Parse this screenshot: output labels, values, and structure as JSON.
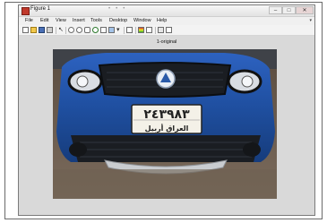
{
  "window": {
    "title": "Figure 1",
    "minimize_icon": "minimize-icon",
    "maximize_icon": "maximize-icon",
    "close_icon": "close-icon"
  },
  "menu": {
    "items": [
      "File",
      "Edit",
      "View",
      "Insert",
      "Tools",
      "Desktop",
      "Window",
      "Help"
    ]
  },
  "toolbar": {
    "icons": [
      "new-figure-icon",
      "open-file-icon",
      "save-icon",
      "print-icon",
      "edit-plot-arrow-icon",
      "zoom-in-icon",
      "zoom-out-icon",
      "pan-icon",
      "rotate-3d-icon",
      "data-cursor-icon",
      "brush-icon",
      "link-icon",
      "insert-colorbar-icon",
      "insert-legend-icon",
      "hide-plot-tools-icon",
      "show-plot-tools-icon"
    ]
  },
  "figure": {
    "axes_title": "1-original",
    "plate_number": "٢٤٣٩٨٣",
    "plate_region": "العراق أربيل"
  },
  "colors": {
    "car_body": "#1f4fa0",
    "plate_background": "#f4f1e8",
    "canvas_background": "#d9d9d9"
  }
}
